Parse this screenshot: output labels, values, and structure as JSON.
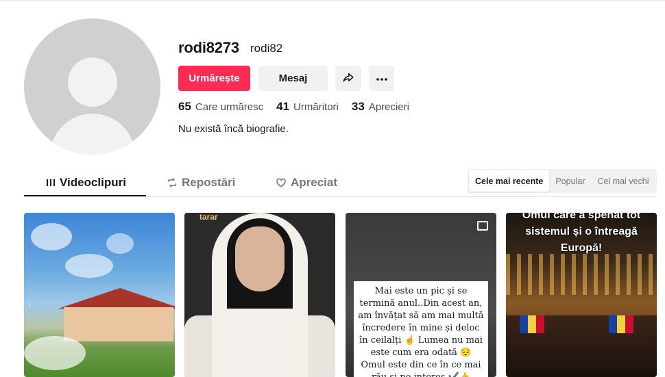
{
  "profile": {
    "username": "rodi8273",
    "nickname": "rodi82",
    "follow_label": "Urmărește",
    "message_label": "Mesaj",
    "bio": "Nu există încă biografie."
  },
  "stats": [
    {
      "value": "65",
      "label": "Care urmăresc"
    },
    {
      "value": "41",
      "label": "Urmăritori"
    },
    {
      "value": "33",
      "label": "Aprecieri"
    }
  ],
  "tabs": [
    {
      "label": "Videoclipuri",
      "icon": "grid-lines-icon",
      "active": true
    },
    {
      "label": "Repostări",
      "icon": "repost-icon",
      "active": false
    },
    {
      "label": "Apreciat",
      "icon": "heart-outline-icon",
      "active": false
    }
  ],
  "sort": {
    "options": [
      "Cele mai recente",
      "Popular",
      "Cel mai vechi"
    ],
    "selected": "Cele mai recente"
  },
  "videos": [
    {
      "overlay_text": ""
    },
    {
      "overlay_text": "tarar"
    },
    {
      "overlay_text": "Mai este un pic și se termină anul..Din acest an, am învățat să am mai multă încredere în mine și deloc în ceilalți ☝ Lumea nu mai este cum era odată 😔 Omul este din ce în ce mai rău și pe interes ✔️👍"
    },
    {
      "overlay_text": "Omul care a spenat tot sistemul și o întreagă Europă!"
    }
  ],
  "colors": {
    "accent": "#fe2c55",
    "text_primary": "#161823",
    "text_secondary": "#75767b",
    "button_bg": "#f1f1f2"
  }
}
